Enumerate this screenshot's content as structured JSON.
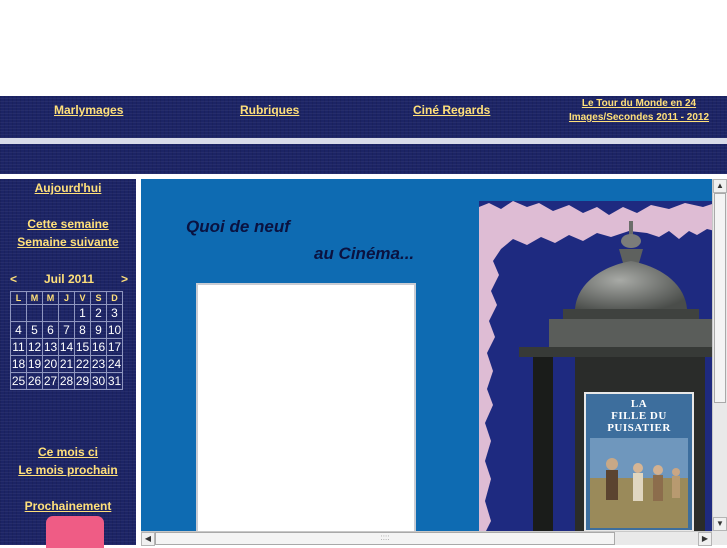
{
  "nav": {
    "items": [
      {
        "label": "Marlymages"
      },
      {
        "label": "Rubriques"
      },
      {
        "label": "Ciné Regards"
      },
      {
        "label": "Le Tour du Monde en 24 Images/Secondes 2011 - 2012"
      }
    ]
  },
  "sidebar": {
    "today": "Aujourd'hui",
    "this_week": "Cette semaine",
    "next_week": "Semaine suivante",
    "calendar": {
      "prev": "<",
      "month": "Juil 2011",
      "next": ">",
      "days": [
        "L",
        "M",
        "M",
        "J",
        "V",
        "S",
        "D"
      ],
      "rows": [
        [
          "",
          "",
          "",
          "",
          "1",
          "2",
          "3"
        ],
        [
          "4",
          "5",
          "6",
          "7",
          "8",
          "9",
          "10"
        ],
        [
          "11",
          "12",
          "13",
          "14",
          "15",
          "16",
          "17"
        ],
        [
          "18",
          "19",
          "20",
          "21",
          "22",
          "23",
          "24"
        ],
        [
          "25",
          "26",
          "27",
          "28",
          "29",
          "30",
          "31"
        ]
      ]
    },
    "this_month": "Ce mois ci",
    "next_month": "Le mois prochain",
    "upcoming": "Prochainement"
  },
  "main": {
    "heading_line1": "Quoi de neuf",
    "heading_line2": "au Cinéma...",
    "poster": {
      "title_line1": "LA",
      "title_line2": "FILLE DU",
      "title_line3": "PUISATIER"
    }
  },
  "scrollbars": {
    "up": "▲",
    "down": "▼",
    "left": "◀",
    "right": "▶",
    "grip": "::::"
  },
  "colors": {
    "navy": "#1c2465",
    "link_yellow": "#ffe07a",
    "content_blue": "#0e6bb2",
    "accent_pink": "#ef5c85"
  }
}
